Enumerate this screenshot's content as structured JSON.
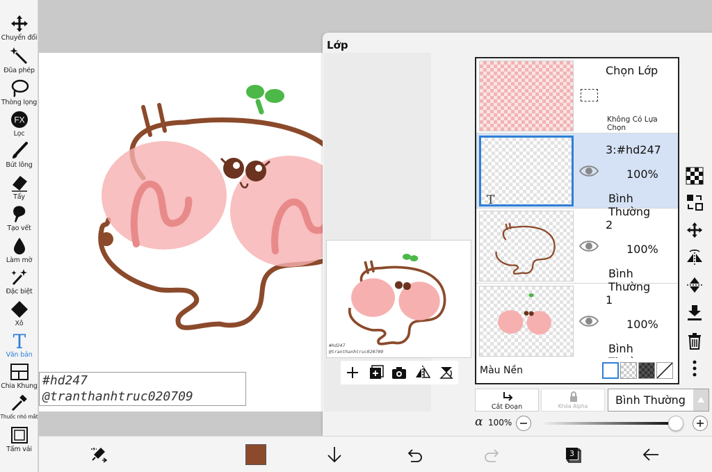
{
  "toolbar": {
    "tools": [
      {
        "label": "Chuyển đổi",
        "icon": "move-icon"
      },
      {
        "label": "Đũa phép",
        "icon": "magic-wand-icon"
      },
      {
        "label": "Thòng lọng",
        "icon": "lasso-icon"
      },
      {
        "label": "Lọc",
        "icon": "fx-filter-icon"
      },
      {
        "label": "Bút lông",
        "icon": "brush-icon"
      },
      {
        "label": "Tẩy",
        "icon": "eraser-icon"
      },
      {
        "label": "Tạo vết",
        "icon": "smudge-icon"
      },
      {
        "label": "Làm mờ",
        "icon": "blur-drop-icon"
      },
      {
        "label": "Đặc biệt",
        "icon": "special-brush-icon"
      },
      {
        "label": "Xô",
        "icon": "bucket-icon"
      },
      {
        "label": "Văn bản",
        "icon": "text-icon"
      },
      {
        "label": "Chia Khung",
        "icon": "frame-divider-icon"
      },
      {
        "label": "Thuốc nhỏ mắt",
        "icon": "eyedropper-icon"
      },
      {
        "label": "Tấm vải",
        "icon": "canvas-icon"
      }
    ],
    "active_tool": "Văn bản",
    "active_color": "#2f7fd8"
  },
  "canvas": {
    "signature_lines": [
      "#hd247",
      "@tranthanhtruc020709"
    ]
  },
  "layer_panel": {
    "title": "Lớp",
    "preview_signature": [
      "#hd247",
      "@tranthanhtruc020709"
    ],
    "preview_toolbar": [
      "add-icon",
      "add-layer-icon",
      "camera-icon",
      "flip-horizontal-icon",
      "rotate-icon"
    ],
    "selection_layer": {
      "name": "Chọn Lớp",
      "status": "Không Có Lựa Chọn"
    },
    "layers": [
      {
        "name": "3:#hd247",
        "opacity": "100%",
        "mode": "Bình Thường",
        "selected": true,
        "type": "text"
      },
      {
        "name": "2",
        "opacity": "100%",
        "mode": "Bình Thường",
        "selected": false,
        "type": "outline"
      },
      {
        "name": "1",
        "opacity": "100%",
        "mode": "Bình Thường",
        "selected": false,
        "type": "color"
      }
    ],
    "background": {
      "label": "Màu Nền",
      "options": [
        "white",
        "checker",
        "dark-checker",
        "none"
      ]
    },
    "side_icons": [
      "checker-icon",
      "transfer-icon",
      "move-icon",
      "flip-horizontal-icon",
      "flip-vertical-icon",
      "merge-down-icon",
      "trash-icon",
      "more-icon"
    ],
    "clipping_label": "Cắt Đoạn",
    "alpha_lock_label": "Khóa Alpha",
    "blend_mode": "Bình Thường",
    "alpha_symbol": "α",
    "alpha_value": "100%",
    "alpha_level": 1.0
  },
  "bottombar": {
    "icons": [
      "transform-icon",
      "down-arrow-icon",
      "undo-icon",
      "redo-icon",
      "layers-icon",
      "back-icon"
    ],
    "brush_color": "#8b4a2b",
    "layer_count": "3"
  },
  "colors": {
    "stroke": "#8b4a2b",
    "blush": "#f6b0b0",
    "blush_line": "#e98a8a",
    "sprout": "#4cb848",
    "selection": "#d5e2f5"
  }
}
